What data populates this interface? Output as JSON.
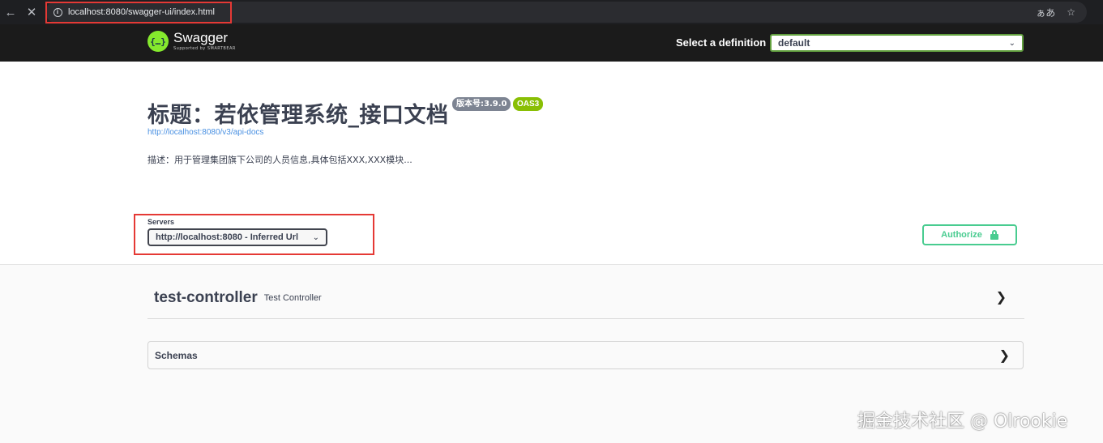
{
  "browser": {
    "url": "localhost:8080/swagger-ui/index.html",
    "back_icon": "back-arrow-icon",
    "stop_icon": "close-icon",
    "info_icon": "info-icon",
    "translate_glyph": "ぁあ",
    "star_icon": "star-icon"
  },
  "topbar": {
    "logo_glyph": "{…}",
    "logo_name": "Swagger",
    "logo_sub": "Supported by SMARTBEAR",
    "definition_label": "Select a definition",
    "definition_value": "default"
  },
  "info": {
    "title": "标题：若依管理系统_接口文档",
    "version_badge": "版本号:3.9.0",
    "oas_badge": "OAS3",
    "api_docs_link": "http://localhost:8080/v3/api-docs",
    "description": "描述：用于管理集团旗下公司的人员信息,具体包括XXX,XXX模块..."
  },
  "servers": {
    "label": "Servers",
    "selected": "http://localhost:8080 - Inferred Url",
    "authorize_label": "Authorize"
  },
  "tags": [
    {
      "name": "test-controller",
      "description": "Test Controller"
    }
  ],
  "schemas": {
    "label": "Schemas"
  },
  "watermark": "掘金技术社区 @ Olrookie",
  "colors": {
    "swagger_green": "#85ea2d",
    "topbar_bg": "#1b1b1b",
    "authorize_green": "#49cc90",
    "oas_badge": "#89bf04",
    "version_badge": "#7d8492",
    "link_blue": "#4990e2",
    "highlight_red": "#e53935"
  }
}
